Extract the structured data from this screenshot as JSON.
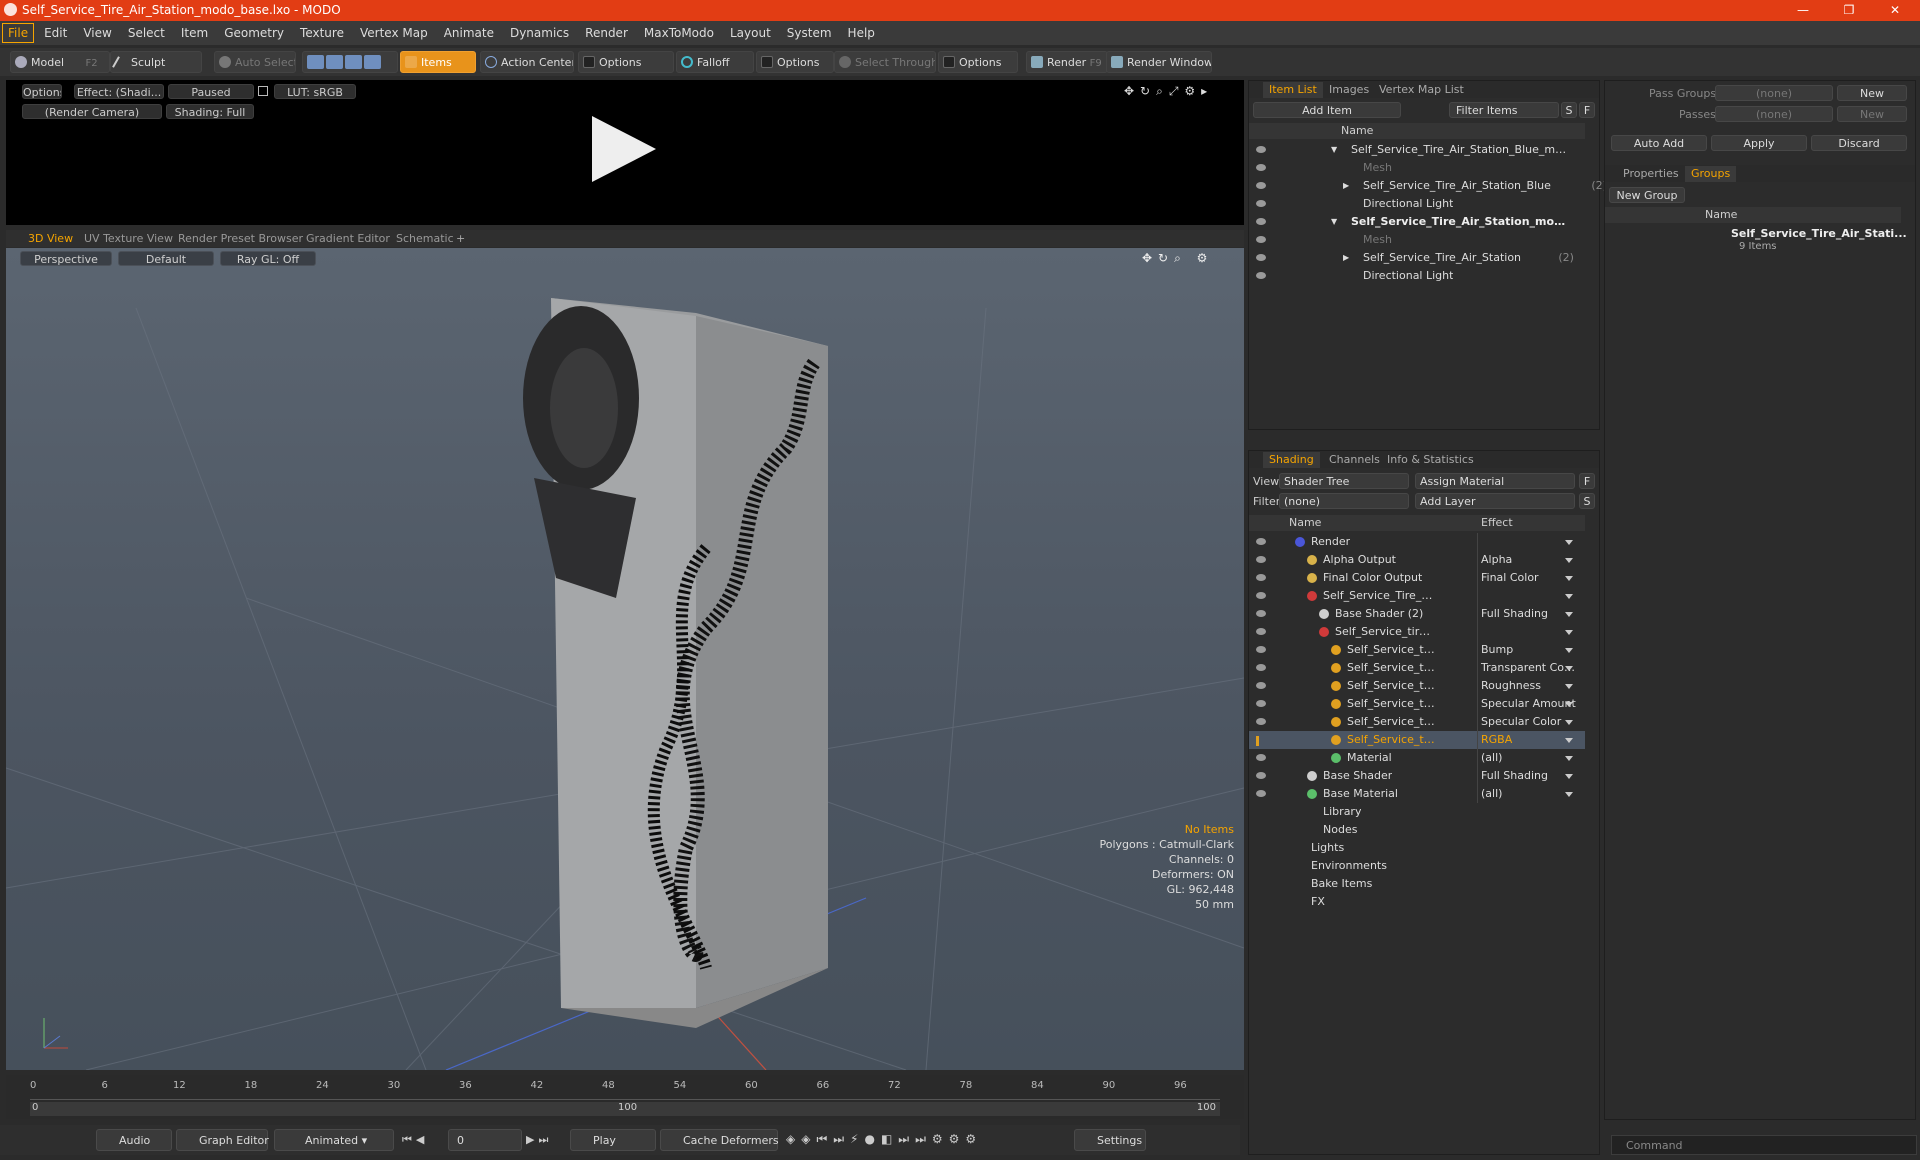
{
  "window": {
    "title": "Self_Service_Tire_Air_Station_modo_base.lxo - MODO"
  },
  "menu": [
    "File",
    "Edit",
    "View",
    "Select",
    "Item",
    "Geometry",
    "Texture",
    "Vertex Map",
    "Animate",
    "Dynamics",
    "Render",
    "MaxToModo",
    "Layout",
    "System",
    "Help"
  ],
  "toolbar": {
    "model": "Model",
    "model_key": "F2",
    "sculpt": "Sculpt",
    "auto_select": "Auto Select",
    "items": "Items",
    "action_center": "Action Center",
    "options1": "Options",
    "falloff": "Falloff",
    "options2": "Options",
    "select_through": "Select Through",
    "options3": "Options",
    "render": "Render",
    "render_key": "F9",
    "render_window": "Render Window"
  },
  "preview": {
    "options": "Options",
    "effect": "Effect: (Shadi...",
    "paused": "Paused",
    "lut": "LUT: sRGB",
    "camera": "(Render Camera)",
    "shading": "Shading: Full"
  },
  "viewport_tabs": [
    "3D View",
    "UV Texture View",
    "Render Preset Browser",
    "Gradient Editor",
    "Schematic"
  ],
  "viewport": {
    "projection": "Perspective",
    "style": "Default",
    "raygl": "Ray GL: Off"
  },
  "stats": {
    "no_items": "No Items",
    "polygons": "Polygons : Catmull-Clark",
    "channels": "Channels: 0",
    "deformers": "Deformers: ON",
    "gl": "GL: 962,448",
    "lens": "50 mm"
  },
  "timeline": {
    "ticks": [
      "0",
      "6",
      "12",
      "18",
      "24",
      "30",
      "36",
      "42",
      "48",
      "54",
      "60",
      "66",
      "72",
      "78",
      "84",
      "90",
      "96"
    ],
    "range_start": "0",
    "range_mid": "100",
    "range_end": "100"
  },
  "bottombar": {
    "audio": "Audio",
    "graph_editor": "Graph Editor",
    "animated": "Animated",
    "frame": "0",
    "play": "Play",
    "cache": "Cache Deformers",
    "settings": "Settings"
  },
  "itemlist": {
    "tabs": [
      "Item List",
      "Images",
      "Vertex Map List"
    ],
    "add_item": "Add Item",
    "filter_items": "Filter Items",
    "s": "S",
    "f": "F",
    "col_name": "Name",
    "rows": [
      {
        "label": "Self_Service_Tire_Air_Station_Blue_modo ...",
        "count": "",
        "indent": 0,
        "arrow": "▼",
        "dim": false,
        "bold": false
      },
      {
        "label": "Mesh",
        "count": "",
        "indent": 1,
        "arrow": "",
        "dim": true,
        "bold": false
      },
      {
        "label": "Self_Service_Tire_Air_Station_Blue",
        "count": "(2)",
        "indent": 1,
        "arrow": "▶",
        "dim": false,
        "bold": false
      },
      {
        "label": "Directional Light",
        "count": "",
        "indent": 1,
        "arrow": "",
        "dim": false,
        "bold": false
      },
      {
        "label": "Self_Service_Tire_Air_Station_mod...",
        "count": "",
        "indent": 0,
        "arrow": "▼",
        "dim": false,
        "bold": true
      },
      {
        "label": "Mesh",
        "count": "",
        "indent": 1,
        "arrow": "",
        "dim": true,
        "bold": false
      },
      {
        "label": "Self_Service_Tire_Air_Station",
        "count": "(2)",
        "indent": 1,
        "arrow": "▶",
        "dim": false,
        "bold": false
      },
      {
        "label": "Directional Light",
        "count": "",
        "indent": 1,
        "arrow": "",
        "dim": false,
        "bold": false
      }
    ]
  },
  "groups": {
    "pass_groups": "Pass Groups",
    "passes": "Passes",
    "none": "(none)",
    "new": "New",
    "auto_add": "Auto Add",
    "apply": "Apply",
    "discard": "Discard",
    "tabs": [
      "Properties",
      "Groups"
    ],
    "new_group": "New Group",
    "col_name": "Name",
    "item": "Self_Service_Tire_Air_Stati...",
    "item_count": "9 Items"
  },
  "shading": {
    "tabs": [
      "Shading",
      "Channels",
      "Info & Statistics"
    ],
    "view_label": "View",
    "view_value": "Shader Tree",
    "assign_material": "Assign Material",
    "filter_label": "Filter",
    "filter_value": "(none)",
    "add_layer": "Add Layer",
    "f": "F",
    "s": "S",
    "col_name": "Name",
    "col_effect": "Effect",
    "rows": [
      {
        "label": "Render",
        "effect": "",
        "indent": 0,
        "dot": "#4a56d8",
        "sel": false
      },
      {
        "label": "Alpha Output",
        "effect": "Alpha",
        "indent": 1,
        "dot": "#d8b24a",
        "sel": false
      },
      {
        "label": "Final Color Output",
        "effect": "Final Color",
        "indent": 1,
        "dot": "#d8b24a",
        "sel": false
      },
      {
        "label": "Self_Service_Tire_Air_Stati ...",
        "effect": "",
        "indent": 1,
        "dot": "#d03a3a",
        "sel": false
      },
      {
        "label": "Base Shader",
        "count": "(2)",
        "effect": "Full Shading",
        "indent": 2,
        "dot": "#cfcfcf",
        "sel": false
      },
      {
        "label": "Self_Service_tire_air_sta ...",
        "effect": "",
        "indent": 2,
        "dot": "#d03a3a",
        "sel": false
      },
      {
        "label": "Self_Service_tire_air_s...",
        "effect": "Bump",
        "indent": 3,
        "dot": "#e0a020",
        "sel": false
      },
      {
        "label": "Self_Service_tire_air_s...",
        "effect": "Transparent Color",
        "indent": 3,
        "dot": "#e0a020",
        "sel": false
      },
      {
        "label": "Self_Service_tire_air_s...",
        "effect": "Roughness",
        "indent": 3,
        "dot": "#e0a020",
        "sel": false
      },
      {
        "label": "Self_Service_tire_air_s...",
        "effect": "Specular Amount",
        "indent": 3,
        "dot": "#e0a020",
        "sel": false
      },
      {
        "label": "Self_Service_tire_air_s...",
        "effect": "Specular Color",
        "indent": 3,
        "dot": "#e0a020",
        "sel": false
      },
      {
        "label": "Self_Service_tire_air_s...",
        "effect": "RGBA",
        "indent": 3,
        "dot": "#e0a020",
        "sel": true
      },
      {
        "label": "Material",
        "effect": "(all)",
        "indent": 3,
        "dot": "#5bbf6a",
        "sel": false
      },
      {
        "label": "Base Shader",
        "effect": "Full Shading",
        "indent": 1,
        "dot": "#cfcfcf",
        "sel": false
      },
      {
        "label": "Base Material",
        "effect": "(all)",
        "indent": 1,
        "dot": "#5bbf6a",
        "sel": false
      },
      {
        "label": "Library",
        "effect": "",
        "indent": 1,
        "dot": "",
        "sel": false
      },
      {
        "label": "Nodes",
        "effect": "",
        "indent": 1,
        "dot": "",
        "sel": false
      },
      {
        "label": "Lights",
        "effect": "",
        "indent": 0,
        "dot": "",
        "sel": false
      },
      {
        "label": "Environments",
        "effect": "",
        "indent": 0,
        "dot": "",
        "sel": false
      },
      {
        "label": "Bake Items",
        "effect": "",
        "indent": 0,
        "dot": "",
        "sel": false
      },
      {
        "label": "FX",
        "effect": "",
        "indent": 0,
        "dot": "",
        "sel": false
      }
    ]
  },
  "command": {
    "placeholder": "Command"
  },
  "colors": {
    "accent": "#f5a400",
    "titlebar": "#e23d14"
  }
}
